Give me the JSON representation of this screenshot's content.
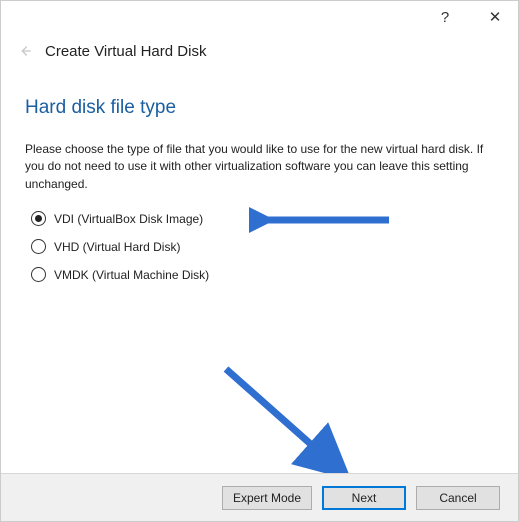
{
  "window": {
    "help_glyph": "?",
    "close_glyph": "✕"
  },
  "header": {
    "wizard_title": "Create Virtual Hard Disk"
  },
  "page": {
    "heading": "Hard disk file type",
    "description": "Please choose the type of file that you would like to use for the new virtual hard disk. If you do not need to use it with other virtualization software you can leave this setting unchanged."
  },
  "options": [
    {
      "label": "VDI (VirtualBox Disk Image)",
      "selected": true
    },
    {
      "label": "VHD (Virtual Hard Disk)",
      "selected": false
    },
    {
      "label": "VMDK (Virtual Machine Disk)",
      "selected": false
    }
  ],
  "footer": {
    "expert_mode": "Expert Mode",
    "next": "Next",
    "cancel": "Cancel"
  },
  "annotations": {
    "arrow_color": "#2f6fd0"
  }
}
